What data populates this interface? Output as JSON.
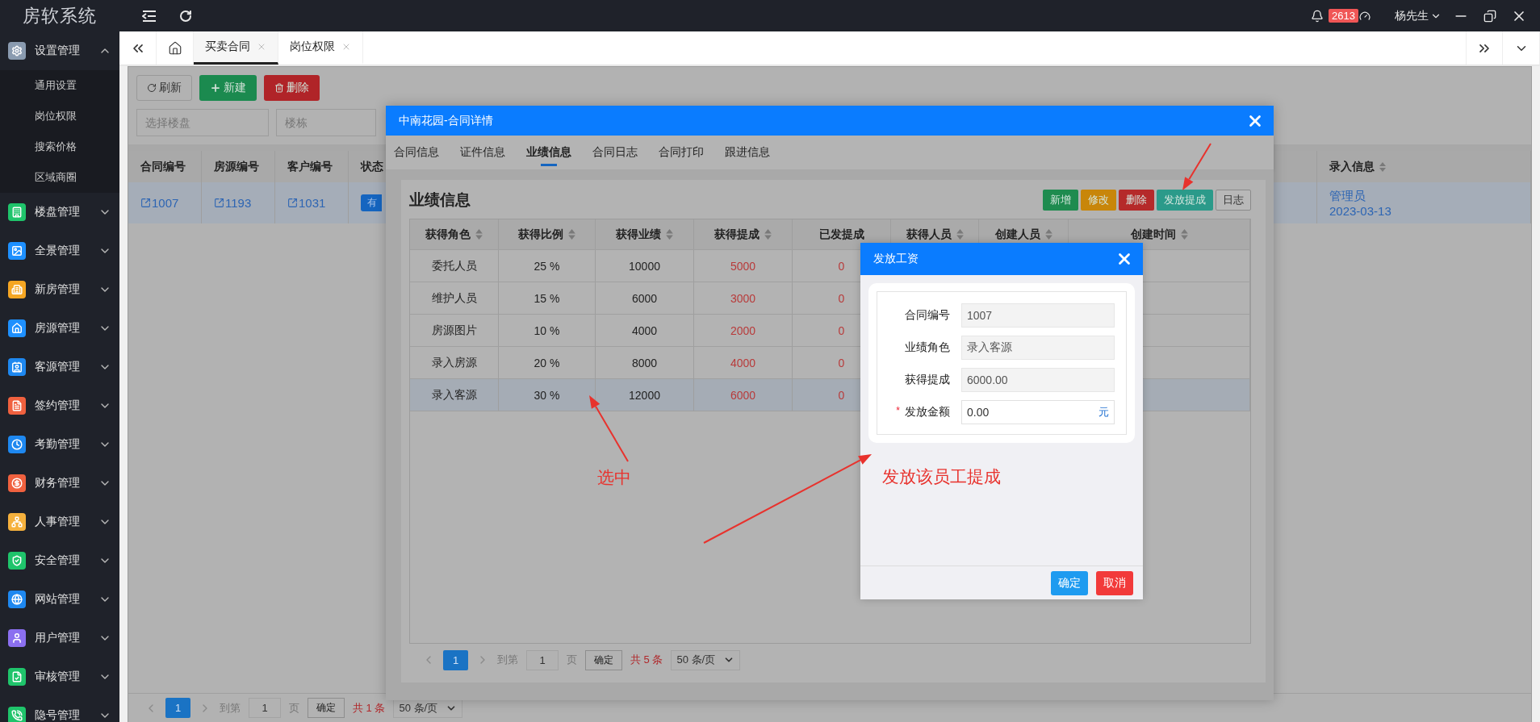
{
  "app": {
    "title": "房软系统"
  },
  "header": {
    "notification_count": "2613",
    "user_name": "杨先生"
  },
  "sidebar": {
    "items": [
      {
        "label": "设置管理",
        "color": "#8a9bb0",
        "expanded": true,
        "children": [
          {
            "label": "通用设置"
          },
          {
            "label": "岗位权限"
          },
          {
            "label": "搜索价格"
          },
          {
            "label": "区域商圈"
          }
        ]
      },
      {
        "label": "楼盘管理",
        "color": "#1fc46b",
        "expanded": false
      },
      {
        "label": "全景管理",
        "color": "#1e90ff",
        "expanded": false
      },
      {
        "label": "新房管理",
        "color": "#f5a623",
        "expanded": false
      },
      {
        "label": "房源管理",
        "color": "#1e90ff",
        "expanded": false
      },
      {
        "label": "客源管理",
        "color": "#1e88f0",
        "expanded": false
      },
      {
        "label": "签约管理",
        "color": "#f0613f",
        "expanded": false
      },
      {
        "label": "考勤管理",
        "color": "#1e88f0",
        "expanded": false
      },
      {
        "label": "财务管理",
        "color": "#f0613f",
        "expanded": false
      },
      {
        "label": "人事管理",
        "color": "#f5b13d",
        "expanded": false
      },
      {
        "label": "安全管理",
        "color": "#1fc46b",
        "expanded": false
      },
      {
        "label": "网站管理",
        "color": "#1e88f0",
        "expanded": false
      },
      {
        "label": "用户管理",
        "color": "#8b6ff0",
        "expanded": false
      },
      {
        "label": "审核管理",
        "color": "#1fc46b",
        "expanded": false
      },
      {
        "label": "隐号管理",
        "color": "#1fc46b",
        "expanded": false
      }
    ]
  },
  "tabs": [
    {
      "label": "买卖合同",
      "selected": true
    },
    {
      "label": "岗位权限",
      "selected": false
    }
  ],
  "page": {
    "toolbar": [
      {
        "label": "刷新",
        "kind": "refresh"
      },
      {
        "label": "新建",
        "kind": "create"
      },
      {
        "label": "删除",
        "kind": "delete"
      }
    ],
    "filters": [
      {
        "placeholder": "选择楼盘"
      },
      {
        "placeholder": "楼栋"
      }
    ],
    "table": {
      "columns": [
        {
          "label": "合同编号",
          "sortable": false
        },
        {
          "label": "房源编号",
          "sortable": false
        },
        {
          "label": "客户编号",
          "sortable": false
        },
        {
          "label": "状态",
          "sortable": false
        },
        {
          "label": "录入信息",
          "sortable": true
        }
      ],
      "rows": [
        {
          "contract": "1007",
          "house": "1193",
          "customer": "1031",
          "status": "有",
          "entered_by": "管理员",
          "entered_date": "2023-03-13",
          "selected": true
        }
      ]
    },
    "pager": {
      "page": "1",
      "goto_label": "到第",
      "goto_value": "1",
      "page_unit": "页",
      "confirm": "确定",
      "total": "共 1 条",
      "page_size": "50 条/页"
    }
  },
  "contract_dialog": {
    "title": "中南花园-合同详情",
    "tabs": [
      {
        "label": "合同信息",
        "selected": false
      },
      {
        "label": "证件信息",
        "selected": false
      },
      {
        "label": "业绩信息",
        "selected": true
      },
      {
        "label": "合同日志",
        "selected": false
      },
      {
        "label": "合同打印",
        "selected": false
      },
      {
        "label": "跟进信息",
        "selected": false
      }
    ],
    "section_title": "业绩信息",
    "actions": [
      {
        "label": "新增",
        "kind": "add"
      },
      {
        "label": "修改",
        "kind": "edit"
      },
      {
        "label": "删除",
        "kind": "delete"
      },
      {
        "label": "发放提成",
        "kind": "pay"
      },
      {
        "label": "日志",
        "kind": "log"
      }
    ],
    "table": {
      "columns": [
        {
          "label": "获得角色",
          "sortable": true
        },
        {
          "label": "获得比例",
          "sortable": true
        },
        {
          "label": "获得业绩",
          "sortable": true
        },
        {
          "label": "获得提成",
          "sortable": true
        },
        {
          "label": "已发提成",
          "sortable": false
        },
        {
          "label": "获得人员",
          "sortable": true
        },
        {
          "label": "创建人员",
          "sortable": true
        },
        {
          "label": "创建时间",
          "sortable": true
        }
      ],
      "rows": [
        {
          "cells": [
            "委托人员",
            "25 %",
            "10000",
            "5000",
            "0"
          ],
          "selected": false
        },
        {
          "cells": [
            "维护人员",
            "15 %",
            "6000",
            "3000",
            "0"
          ],
          "selected": false
        },
        {
          "cells": [
            "房源图片",
            "10 %",
            "4000",
            "2000",
            "0"
          ],
          "selected": false
        },
        {
          "cells": [
            "录入房源",
            "20 %",
            "8000",
            "4000",
            "0"
          ],
          "selected": false
        },
        {
          "cells": [
            "录入客源",
            "30 %",
            "12000",
            "6000",
            "0"
          ],
          "selected": true
        }
      ]
    },
    "pager": {
      "page": "1",
      "goto_label": "到第",
      "goto_value": "1",
      "page_unit": "页",
      "confirm": "确定",
      "total": "共 5 条",
      "page_size": "50 条/页"
    }
  },
  "pay_dialog": {
    "title": "发放工资",
    "fields": [
      {
        "label": "合同编号",
        "value": "1007",
        "disabled": true
      },
      {
        "label": "业绩角色",
        "value": "录入客源",
        "disabled": true
      },
      {
        "label": "获得提成",
        "value": "6000.00",
        "disabled": true
      },
      {
        "label": "发放金额",
        "value": "0.00",
        "disabled": false,
        "required_mark": "*",
        "unit": "元"
      }
    ],
    "buttons": [
      {
        "label": "确定",
        "kind": "primary"
      },
      {
        "label": "取消",
        "kind": "danger"
      }
    ]
  },
  "annotations": [
    {
      "text": "选中"
    },
    {
      "text": "发放该员工提成"
    }
  ]
}
